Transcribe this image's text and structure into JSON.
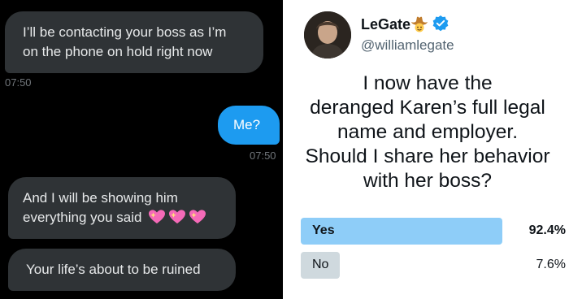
{
  "chat": {
    "messages": [
      {
        "direction": "incoming",
        "lines": [
          "I’ll be contacting your boss as I’m",
          "on the phone on hold right now"
        ],
        "time": "07:50"
      },
      {
        "direction": "outgoing",
        "lines": [
          "Me?"
        ],
        "time": "07:50"
      },
      {
        "direction": "incoming",
        "lines": [
          "And I will be showing him",
          "everything you said"
        ],
        "emoji": [
          "sparkling-heart",
          "sparkling-heart",
          "sparkling-heart"
        ]
      },
      {
        "direction": "incoming",
        "lines": [
          "Your life’s about to be ruined"
        ]
      }
    ]
  },
  "tweet": {
    "display_name": "LeGate",
    "handle": "@williamlegate",
    "name_icons": [
      "cowboy-emoji",
      "verified-badge-icon"
    ],
    "text": "I now have the deranged Karen’s full legal name and employer. Should I share her behavior with her boss?",
    "text_lines": [
      "I now have the",
      "deranged Karen’s full legal",
      "name and employer.",
      "Should I share her behavior",
      "with her boss?"
    ],
    "poll": [
      {
        "label": "Yes",
        "percent": "92.4%",
        "fraction": 0.924,
        "winner": true
      },
      {
        "label": "No",
        "percent": "7.6%",
        "fraction": 0.076,
        "winner": false
      }
    ]
  },
  "colors": {
    "chat_bg": "#000000",
    "incoming_bubble": "#2f3336",
    "outgoing_bubble": "#1d9bf0",
    "poll_winner": "#8ecdf8",
    "poll_loser": "#cfd9de"
  }
}
